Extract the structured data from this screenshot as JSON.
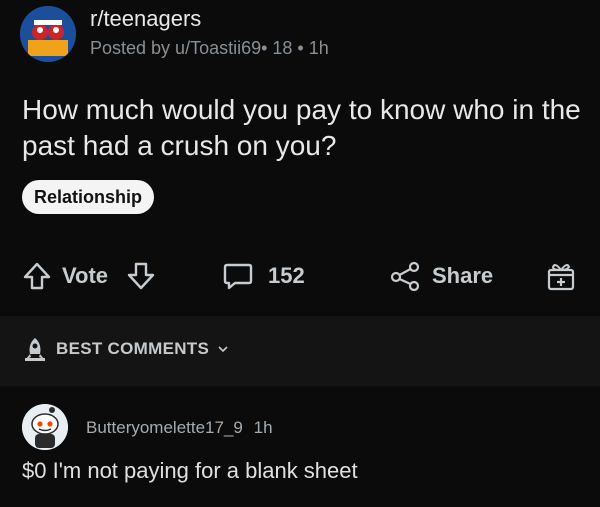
{
  "post": {
    "subreddit": "r/teenagers",
    "posted_by": "Posted by u/Toastii69• 18 • 1h",
    "title": "How much would you pay to know who in the past had a crush on you?",
    "flair": "Relationship"
  },
  "actions": {
    "vote_label": "Vote",
    "comment_count": "152",
    "share_label": "Share"
  },
  "comments_section": {
    "sort_label": "BEST COMMENTS"
  },
  "comment": {
    "username": "Butteryomelette17_9",
    "time": "1h",
    "body": "$0 I'm not paying for a blank sheet"
  },
  "colors": {
    "background": "#0b0b0b",
    "divider": "#141414",
    "flair_bg": "#f4f4f4",
    "text": "#e8e8e8",
    "muted": "#8b8f93"
  }
}
